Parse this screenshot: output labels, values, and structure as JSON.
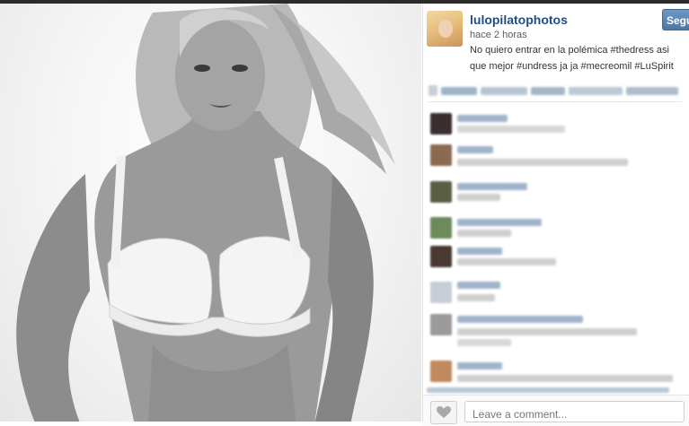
{
  "post": {
    "username": "lulopilatophotos",
    "time": "hace 2 horas",
    "caption": "No quiero entrar en la polémica #thedress asi que mejor #undress ja ja #mecreomil #LuSpirit",
    "follow_label": "Segu"
  },
  "comment_box": {
    "placeholder": "Leave a comment..."
  },
  "icons": {
    "like": "heart-icon"
  },
  "colors": {
    "username": "#1f4f82",
    "follow_button": "#4a77a8"
  }
}
